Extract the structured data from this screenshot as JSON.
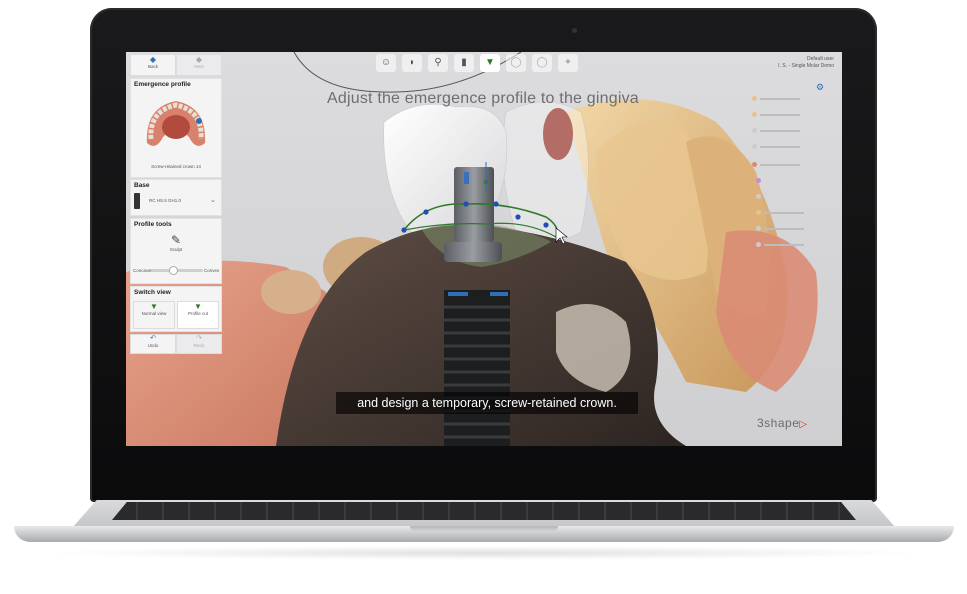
{
  "app": {
    "brand": "3shape",
    "instruction": "Adjust the emergence profile to the gingiva",
    "subtitle": "and design a temporary, screw-retained crown.",
    "user_line1": "Default user",
    "user_line2": "I. S. - Single Molar Demo"
  },
  "left_panel": {
    "back_label": "Back",
    "next_label": "Next",
    "emergence_title": "Emergence profile",
    "thumb_caption": "Screw-retained crown 14",
    "base_title": "Base",
    "base_value": "RC HS.5 GH1.0",
    "profile_tools_title": "Profile tools",
    "sculpt_label": "Sculpt",
    "concave_label": "Concave",
    "convex_label": "Convex",
    "switch_view_title": "Switch view",
    "normal_view_label": "Normal view",
    "profile_view_label": "Profile cut",
    "undo_label": "Undo",
    "redo_label": "Redo"
  },
  "toolbar": {
    "icons": [
      "face-icon",
      "crown-icon",
      "abutment-icon",
      "implant-icon",
      "emergence-icon",
      "tooth-outline-icon",
      "tooth-outline-2-icon",
      "mesh-icon"
    ]
  },
  "colors": {
    "accent": "#2f6fb6",
    "brand_red": "#e2231a",
    "spline": "#2d7a2a",
    "subtitle_bg": "#000000"
  }
}
